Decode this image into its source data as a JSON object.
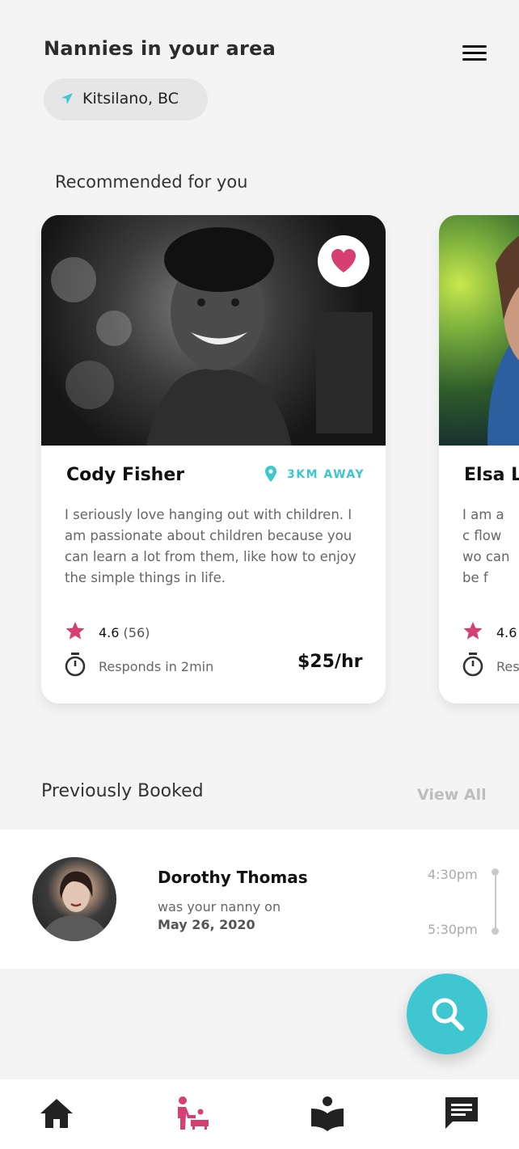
{
  "header": {
    "title": "Nannies in your area",
    "location": "Kitsilano, BC"
  },
  "recommended": {
    "heading": "Recommended for you",
    "cards": [
      {
        "name": "Cody Fisher",
        "distance": "3KM AWAY",
        "bio": "I seriously love hanging out with children. I am passionate about children because you can learn a lot from them, like how to enjoy the simple things in life.",
        "rating": "4.6",
        "reviews": "(56)",
        "responds": "Responds in 2min",
        "price": "$25/hr",
        "favorited": true
      },
      {
        "name": "Elsa L",
        "bio": "I am a c flow wo can be f",
        "rating": "4.6",
        "responds": "Res"
      }
    ]
  },
  "previously_booked": {
    "heading": "Previously Booked",
    "view_all": "View All",
    "items": [
      {
        "name": "Dorothy Thomas",
        "subtitle": "was your nanny on",
        "date": "May 26, 2020",
        "start_time": "4:30pm",
        "end_time": "5:30pm"
      }
    ]
  },
  "colors": {
    "accent": "#3ec7d1",
    "pink": "#d63f72",
    "background": "#f4f4f4"
  },
  "nav": {
    "items": [
      "home-icon",
      "nanny-icon",
      "learn-icon",
      "messages-icon"
    ],
    "active": "nanny-icon"
  }
}
